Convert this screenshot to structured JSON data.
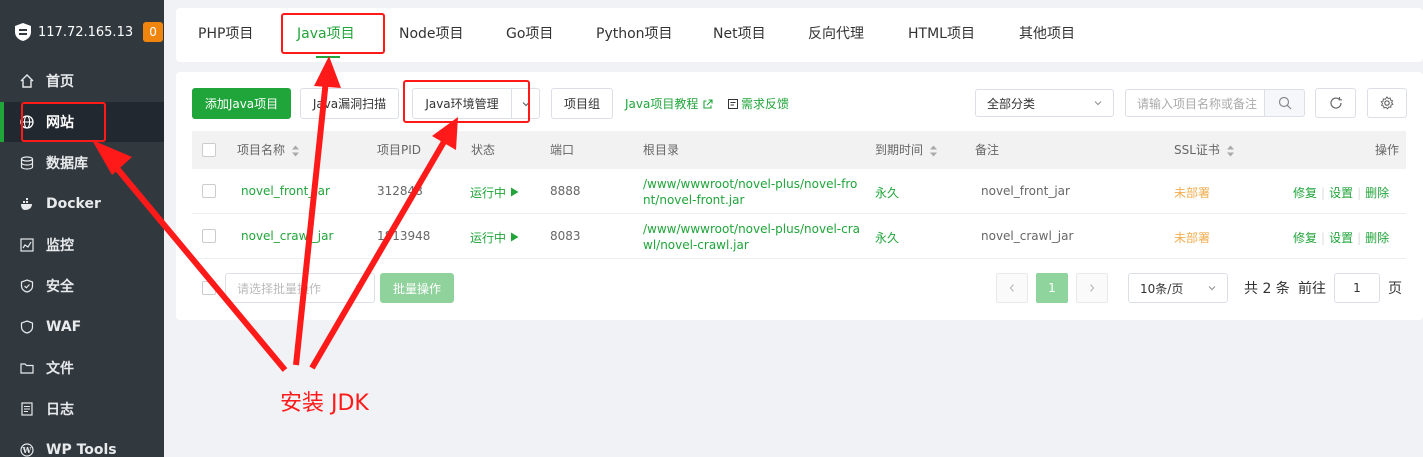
{
  "sidebar": {
    "ip": "117.72.165.13",
    "badge": "0",
    "items": [
      {
        "label": "首页",
        "icon": "home-icon"
      },
      {
        "label": "网站",
        "icon": "globe-icon"
      },
      {
        "label": "数据库",
        "icon": "database-icon"
      },
      {
        "label": "Docker",
        "icon": "docker-icon"
      },
      {
        "label": "监控",
        "icon": "monitor-icon"
      },
      {
        "label": "安全",
        "icon": "shield-icon"
      },
      {
        "label": "WAF",
        "icon": "waf-shield-icon"
      },
      {
        "label": "文件",
        "icon": "folder-icon"
      },
      {
        "label": "日志",
        "icon": "log-icon"
      },
      {
        "label": "WP Tools",
        "icon": "wordpress-icon"
      }
    ]
  },
  "tabs": [
    "PHP项目",
    "Java项目",
    "Node项目",
    "Go项目",
    "Python项目",
    "Net项目",
    "反向代理",
    "HTML项目",
    "其他项目"
  ],
  "toolbar": {
    "add": "添加Java项目",
    "scan": "Java漏洞扫描",
    "env": "Java环境管理",
    "group": "项目组",
    "tutorial": "Java项目教程",
    "feedback": "需求反馈",
    "category": "全部分类",
    "search_placeholder": "请输入项目名称或备注"
  },
  "table": {
    "headers": [
      "项目名称",
      "项目PID",
      "状态",
      "端口",
      "根目录",
      "到期时间",
      "备注",
      "SSL证书",
      "操作"
    ],
    "rows": [
      {
        "name": "novel_front_jar",
        "pid": "312848",
        "status": "运行中",
        "port": "8888",
        "root1": "/www/wwwroot/novel-plus/novel-fro",
        "root2": "nt/novel-front.jar",
        "expire": "永久",
        "remark": "novel_front_jar",
        "ssl": "未部署"
      },
      {
        "name": "novel_crawl_jar",
        "pid": "1813948",
        "status": "运行中",
        "port": "8083",
        "root1": "/www/wwwroot/novel-plus/novel-cra",
        "root2": "wl/novel-crawl.jar",
        "expire": "永久",
        "remark": "novel_crawl_jar",
        "ssl": "未部署"
      }
    ],
    "actions": [
      "修复",
      "设置",
      "删除"
    ]
  },
  "footer": {
    "batch_placeholder": "请选择批量操作",
    "batch_button": "批量操作",
    "page": "1",
    "page_size": "10条/页",
    "total": "共 2 条",
    "goto_label": "前往",
    "goto_value": "1",
    "page_unit": "页"
  },
  "annotation": {
    "text": "安装 JDK",
    "color": "#ff1a1a"
  },
  "colors": {
    "accent": "#20a53a",
    "sidebar_bg": "#31393f",
    "badge": "#f0850d",
    "warning": "#f0ad4e"
  }
}
